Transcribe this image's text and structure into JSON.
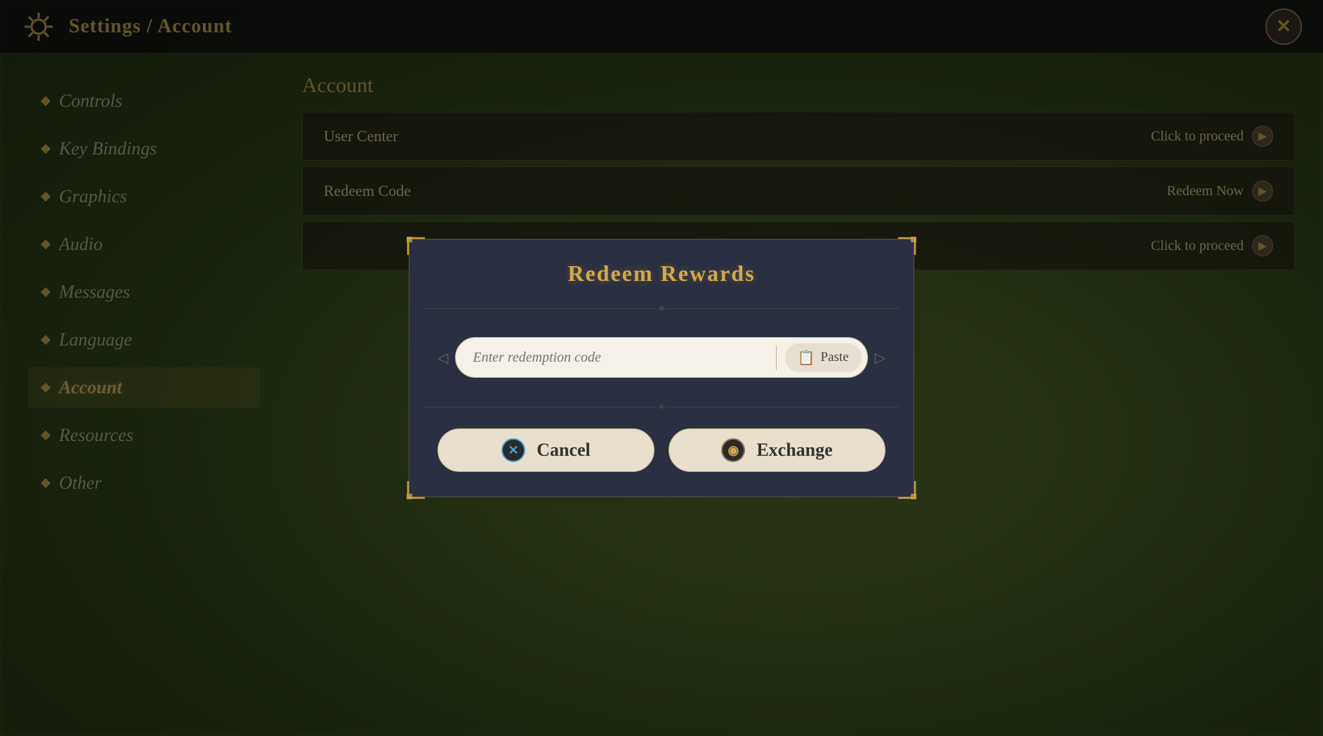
{
  "topbar": {
    "breadcrumb": "Settings / Account",
    "close_label": "✕"
  },
  "sidebar": {
    "items": [
      {
        "id": "controls",
        "label": "Controls",
        "active": false
      },
      {
        "id": "key-bindings",
        "label": "Key Bindings",
        "active": false
      },
      {
        "id": "graphics",
        "label": "Graphics",
        "active": false
      },
      {
        "id": "audio",
        "label": "Audio",
        "active": false
      },
      {
        "id": "messages",
        "label": "Messages",
        "active": false
      },
      {
        "id": "language",
        "label": "Language",
        "active": false
      },
      {
        "id": "account",
        "label": "Account",
        "active": true
      },
      {
        "id": "resources",
        "label": "Resources",
        "active": false
      },
      {
        "id": "other",
        "label": "Other",
        "active": false
      }
    ]
  },
  "content": {
    "section_title": "Account",
    "rows": [
      {
        "id": "user-center",
        "label": "User Center",
        "action": "Click to proceed"
      },
      {
        "id": "redeem-code",
        "label": "Redeem Code",
        "action": "Redeem Now"
      },
      {
        "id": "third-row",
        "label": "",
        "action": "Click to proceed"
      }
    ]
  },
  "modal": {
    "title": "Redeem Rewards",
    "input_placeholder": "Enter redemption code",
    "paste_label": "Paste",
    "cancel_label": "Cancel",
    "exchange_label": "Exchange"
  }
}
